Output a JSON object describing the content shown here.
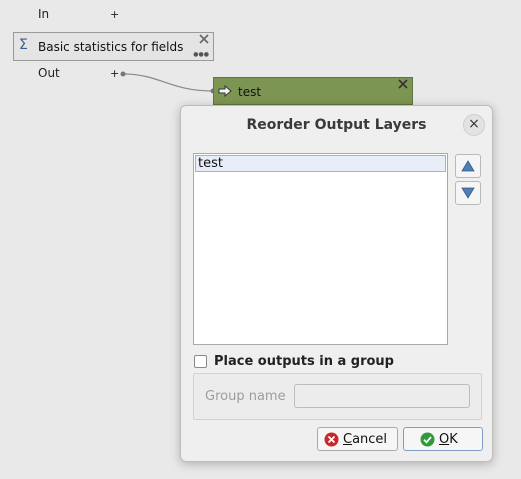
{
  "canvas": {
    "input_port_label": "In",
    "output_port_label": "Out",
    "plus_glyph": "+",
    "algorithm_node": {
      "title": "Basic statistics for fields",
      "icon": "sigma-icon"
    },
    "output_node": {
      "title": "test",
      "icon": "output-arrow-icon"
    }
  },
  "dialog": {
    "title": "Reorder Output Layers",
    "close_glyph": "×",
    "layers": [
      "test"
    ],
    "move_up_icon": "triangle-up-icon",
    "move_down_icon": "triangle-down-icon",
    "group_checkbox_label": "Place outputs in a group",
    "group_checked": false,
    "group_name_label": "Group name",
    "group_name_value": "",
    "cancel_label_underlined": "C",
    "cancel_label_rest": "ancel",
    "ok_label_underlined": "O",
    "ok_label_rest": "K"
  },
  "colors": {
    "output_node_bg": "#7d9553",
    "selection_bg": "#e7eef7",
    "arrow_blue": "#4f7fb3",
    "cancel_red": "#c8282a",
    "ok_green": "#2f9a3a"
  }
}
